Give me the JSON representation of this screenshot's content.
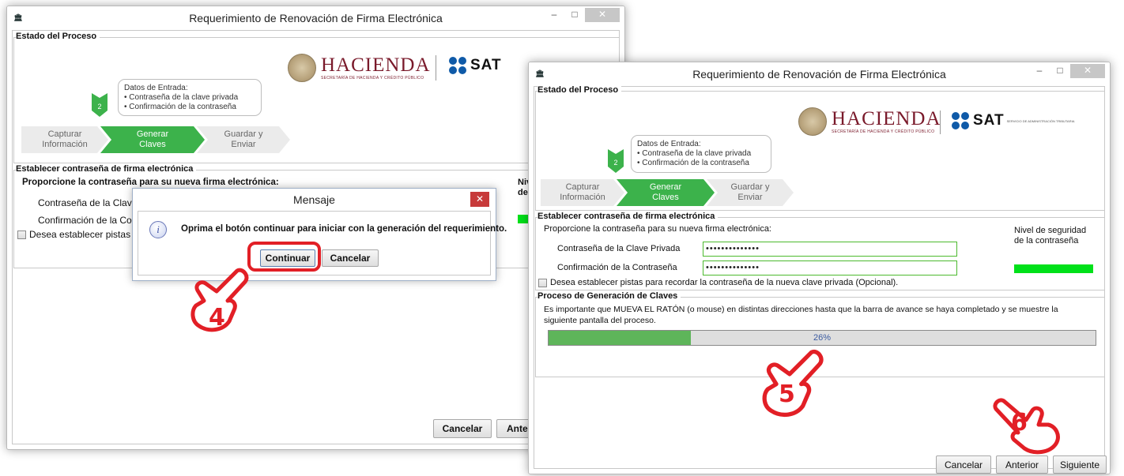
{
  "window1": {
    "title": "Requerimiento de Renovación de Firma Electrónica",
    "estado_legend": "Estado del Proceso",
    "hacienda": {
      "title": "HACIENDA",
      "subtitle": "SECRETARÍA DE HACIENDA Y CRÉDITO PÚBLICO"
    },
    "sat": {
      "word": "SAT",
      "subtitle": "SERVICIO DE ADMINISTRACIÓN TRIBUTARIA"
    },
    "callout": {
      "title": "Datos de Entrada:",
      "items": [
        "Contraseña de la clave privada",
        "Confirmación de la contraseña"
      ]
    },
    "step_number": "2",
    "steps": [
      {
        "line1": "Capturar",
        "line2": "Información"
      },
      {
        "line1": "Generar",
        "line2": "Claves"
      },
      {
        "line1": "Guardar y",
        "line2": "Enviar"
      }
    ],
    "establecer_legend": "Establecer contraseña de firma electrónica",
    "prompt": "Proporcione la contraseña para su nueva firma electrónica:",
    "label_clave": "Contraseña de la Clave",
    "label_confirm": "Confirmación de la Cont",
    "nivel_partial": "Niv",
    "nivel_partial2": "de",
    "checkbox_label": "Desea establecer pistas p",
    "cancel_button": "Cancelar",
    "anterior_button": "Anter"
  },
  "dialog": {
    "title": "Mensaje",
    "close_label": "✕",
    "message": "Oprima el botón continuar para iniciar con la generación del requerimiento.",
    "continue_button": "Continuar",
    "cancel_button": "Cancelar"
  },
  "window2": {
    "title": "Requerimiento de Renovación de Firma Electrónica",
    "estado_legend": "Estado del Proceso",
    "hacienda": {
      "title": "HACIENDA",
      "subtitle": "SECRETARÍA DE HACIENDA Y CRÉDITO PÚBLICO"
    },
    "sat": {
      "word": "SAT",
      "subtitle": "SERVICIO DE ADMINISTRACIÓN TRIBUTARIA"
    },
    "callout": {
      "title": "Datos de Entrada:",
      "items": [
        "Contraseña de la clave privada",
        "Confirmación de la contraseña"
      ]
    },
    "step_number": "2",
    "steps": [
      {
        "line1": "Capturar",
        "line2": "Información"
      },
      {
        "line1": "Generar",
        "line2": "Claves"
      },
      {
        "line1": "Guardar y",
        "line2": "Enviar"
      }
    ],
    "establecer_legend": "Establecer contraseña de firma electrónica",
    "prompt": "Proporcione la contraseña para su nueva firma electrónica:",
    "nivel_label_1": "Nivel de seguridad",
    "nivel_label_2": "de la contraseña",
    "label_clave": "Contraseña de la Clave Privada",
    "label_confirm": "Confirmación de la Contraseña",
    "password_value": "••••••••••••••",
    "confirm_value": "••••••••••••••",
    "checkbox_label": "Desea establecer pistas para recordar la contraseña de la nueva clave privada (Opcional).",
    "proceso_legend": "Proceso de Generación de Claves",
    "proceso_text_1": "Es importante que MUEVA EL RATÓN (o mouse) en distintas direcciones hasta que la barra de avance se haya completado y se muestre la",
    "proceso_text_2": "siguiente pantalla del proceso.",
    "progress_percent": 26,
    "progress_label": "26%",
    "cancel_button": "Cancelar",
    "anterior_button": "Anterior",
    "siguiente_button": "Siguiente"
  },
  "annotations": {
    "step4": "4",
    "step5": "5",
    "step6": "6"
  },
  "colors": {
    "accent_green": "#3cb24b",
    "marker_red": "#e21f26",
    "strength_green": "#00e11a",
    "hacienda": "#7a1a2b",
    "sat_blue": "#0f5aa8"
  }
}
